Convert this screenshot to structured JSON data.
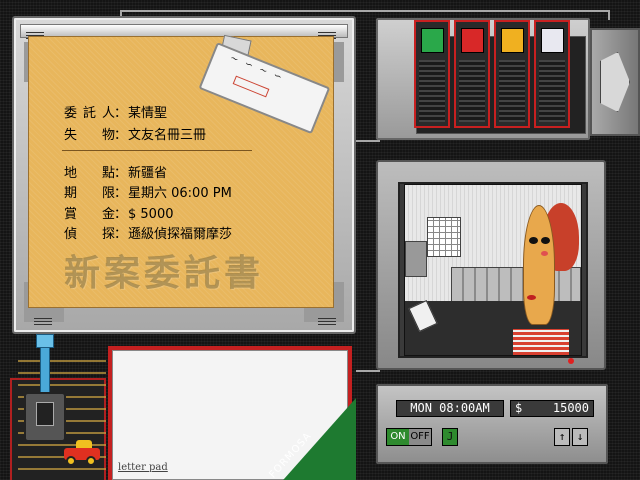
{
  "case_file": {
    "title": "新案委託書",
    "fields": [
      {
        "label": "委託人",
        "value": "某情聖"
      },
      {
        "label": "失　物",
        "value": "文友名冊三冊"
      },
      {
        "label": "地　點",
        "value": "新疆省"
      },
      {
        "label": "期　限",
        "value": "星期六 06:00 PM"
      },
      {
        "label": "賞　金",
        "value": "$ 5000"
      },
      {
        "label": "偵　探",
        "value": "遜級偵探福爾摩莎"
      }
    ]
  },
  "suspects": [
    {
      "name": "suspect-green",
      "color": "#2aa84a"
    },
    {
      "name": "suspect-red",
      "color": "#d82828"
    },
    {
      "name": "suspect-yellow",
      "color": "#f0b020"
    },
    {
      "name": "suspect-white",
      "color": "#e8e8f0"
    }
  ],
  "status": {
    "time": "MON 08:00AM",
    "currency": "$",
    "money": "15000",
    "power_on": "ON",
    "power_off": "OFF",
    "j_button": "J",
    "up_button": "↑",
    "down_button": "↓"
  },
  "letter_pad": {
    "label": "letter pad",
    "brand": "FORMOSA"
  },
  "colors": {
    "accent_red": "#c42020",
    "paper": "#e8b65c",
    "lcd": "#3a3a3a",
    "on_green": "#2e8a2e"
  }
}
